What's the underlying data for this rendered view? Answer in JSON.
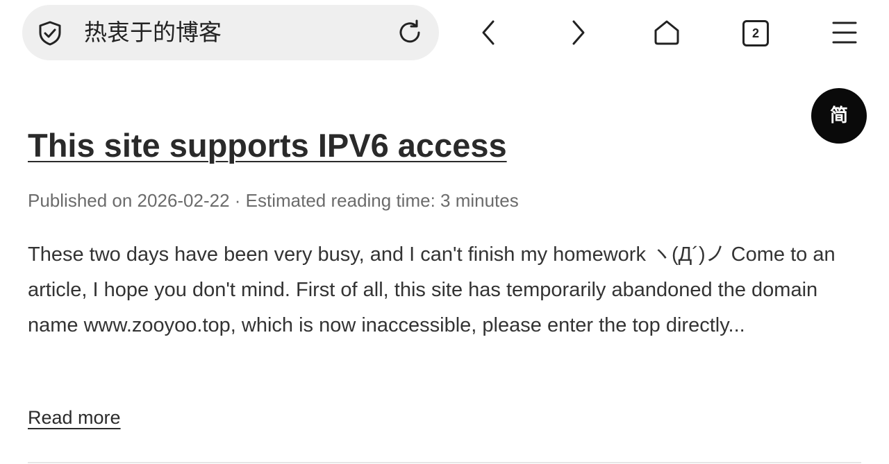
{
  "browser": {
    "site_title": "热衷于的博客",
    "tab_count": "2",
    "icons": {
      "security": "shield-check-icon",
      "reload": "reload-icon",
      "back": "chevron-left-icon",
      "forward": "chevron-right-icon",
      "home": "home-icon",
      "tabs": "tabs-icon",
      "menu": "hamburger-menu-icon"
    }
  },
  "lang_toggle": {
    "label": "简"
  },
  "post": {
    "title": "This site supports IPV6 access",
    "meta": "Published on 2026-02-22 · Estimated reading time: 3 minutes",
    "excerpt": "These two days have been very busy, and I can't finish my homework ヽ(Д´)ノ Come to an article, I hope you don't mind. First of all, this site has temporarily abandoned the domain name www.zooyoo.top, which is now inaccessible, please enter the top directly...",
    "read_more": "Read more"
  },
  "colors": {
    "background": "#ffffff",
    "address_bar": "#efefef",
    "text_primary": "#2a2a2a",
    "text_meta": "#6b6b6b",
    "lang_button_bg": "#0a0a0a"
  }
}
